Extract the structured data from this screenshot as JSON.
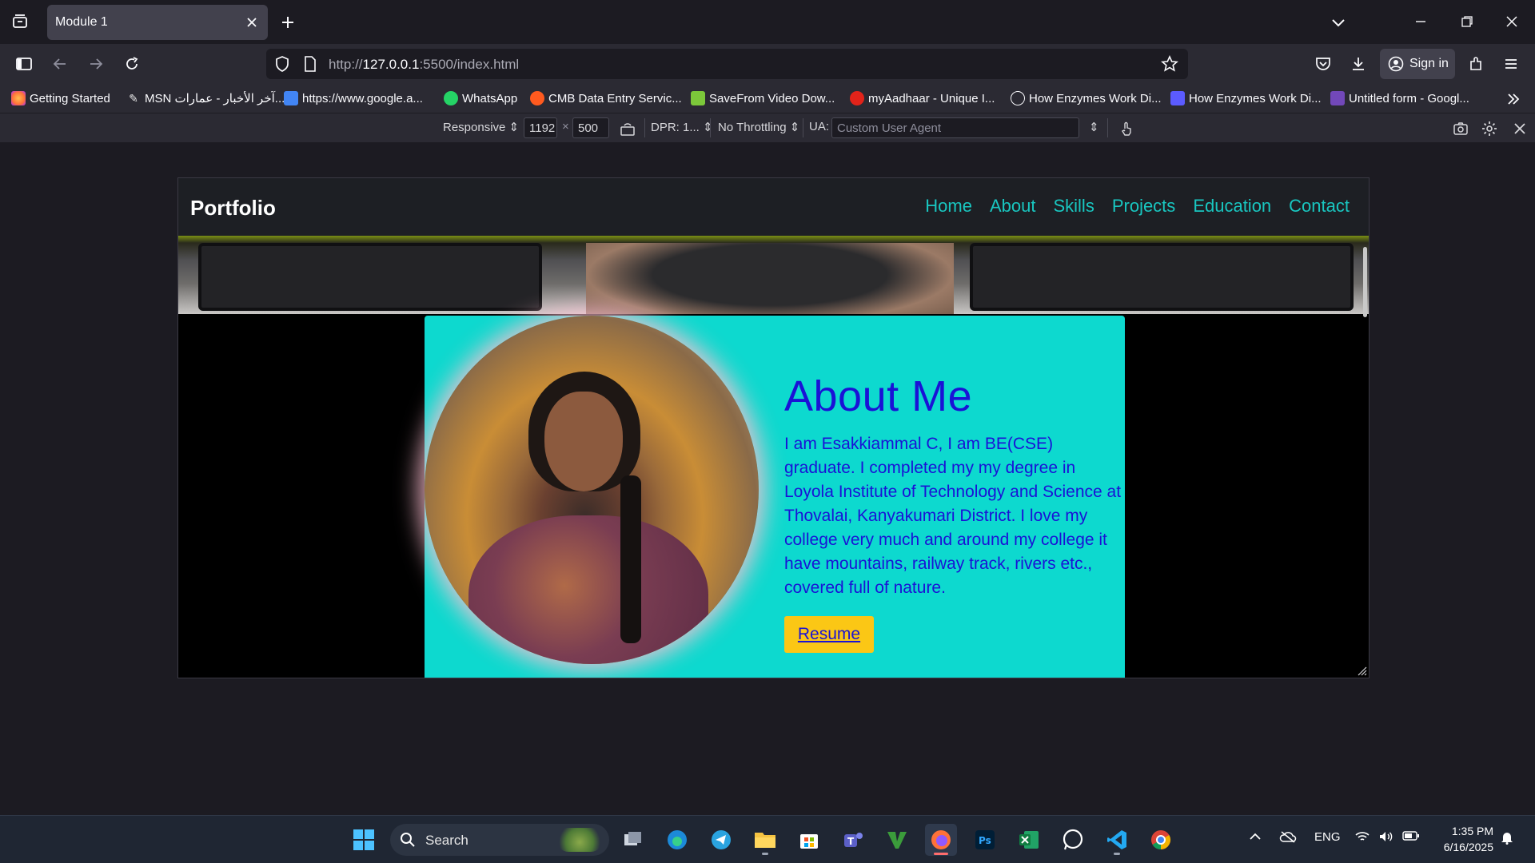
{
  "browser": {
    "tab": {
      "title": "Module 1"
    },
    "url": {
      "prefix": "http://",
      "host": "127.0.0.1",
      "rest": ":5500/index.html"
    },
    "signin_label": "Sign in",
    "bookmarks": [
      {
        "label": "Getting Started",
        "icon": "firefox-icon",
        "color": "#ff7139"
      },
      {
        "label": "MSN آخر الأخبار - عمارات...",
        "icon": "msn-icon",
        "color": "#e6e6e6"
      },
      {
        "label": "https://www.google.a...",
        "icon": "google-icon",
        "color": "#4285f4"
      },
      {
        "label": "WhatsApp",
        "icon": "whatsapp-icon",
        "color": "#25d366"
      },
      {
        "label": "CMB Data Entry Servic...",
        "icon": "cmb-icon",
        "color": "#ff5a1f"
      },
      {
        "label": "SaveFrom Video Dow...",
        "icon": "savefrom-icon",
        "color": "#7cc83a"
      },
      {
        "label": "myAadhaar - Unique I...",
        "icon": "aadhaar-icon",
        "color": "#e2231a"
      },
      {
        "label": "How Enzymes Work Di...",
        "icon": "globe-icon",
        "color": "#fbfbfe"
      },
      {
        "label": "How Enzymes Work Di...",
        "icon": "shield-heart-icon",
        "color": "#5b5bff"
      },
      {
        "label": "Untitled form - Googl...",
        "icon": "forms-icon",
        "color": "#7248b9"
      }
    ]
  },
  "rdm": {
    "device": "Responsive",
    "width": "1192",
    "times": "×",
    "height": "500",
    "dpr": "DPR: 1...",
    "throttling": "No Throttling",
    "ua_label": "UA:",
    "ua_placeholder": "Custom User Agent"
  },
  "site": {
    "brand": "Portfolio",
    "nav": [
      "Home",
      "About",
      "Skills",
      "Projects",
      "Education",
      "Contact"
    ],
    "about": {
      "title": "About Me",
      "text": "I am Esakkiammal C, I am BE(CSE) graduate. I completed my my degree in Loyola Institute of Technology and Science at Thovalai, Kanyakumari District. I love my college very much and around my college it have mountains, railway track, rivers etc., covered full of nature.",
      "button": "Resume"
    },
    "colors": {
      "accent": "#19c6c0",
      "card": "#0dd9cf",
      "text": "#1a12d6",
      "button": "#fbc715"
    }
  },
  "taskbar": {
    "search_label": "Search",
    "language": "ENG",
    "time": "1:35 PM",
    "date": "6/16/2025",
    "apps": [
      "windows-start-icon",
      "task-view-icon",
      "edge-icon",
      "telegram-icon",
      "file-explorer-icon",
      "store-icon",
      "teams-icon",
      "vim-icon",
      "firefox-icon",
      "photoshop-icon",
      "excel-icon",
      "whatsapp-icon",
      "vscode-icon",
      "chrome-icon"
    ]
  }
}
